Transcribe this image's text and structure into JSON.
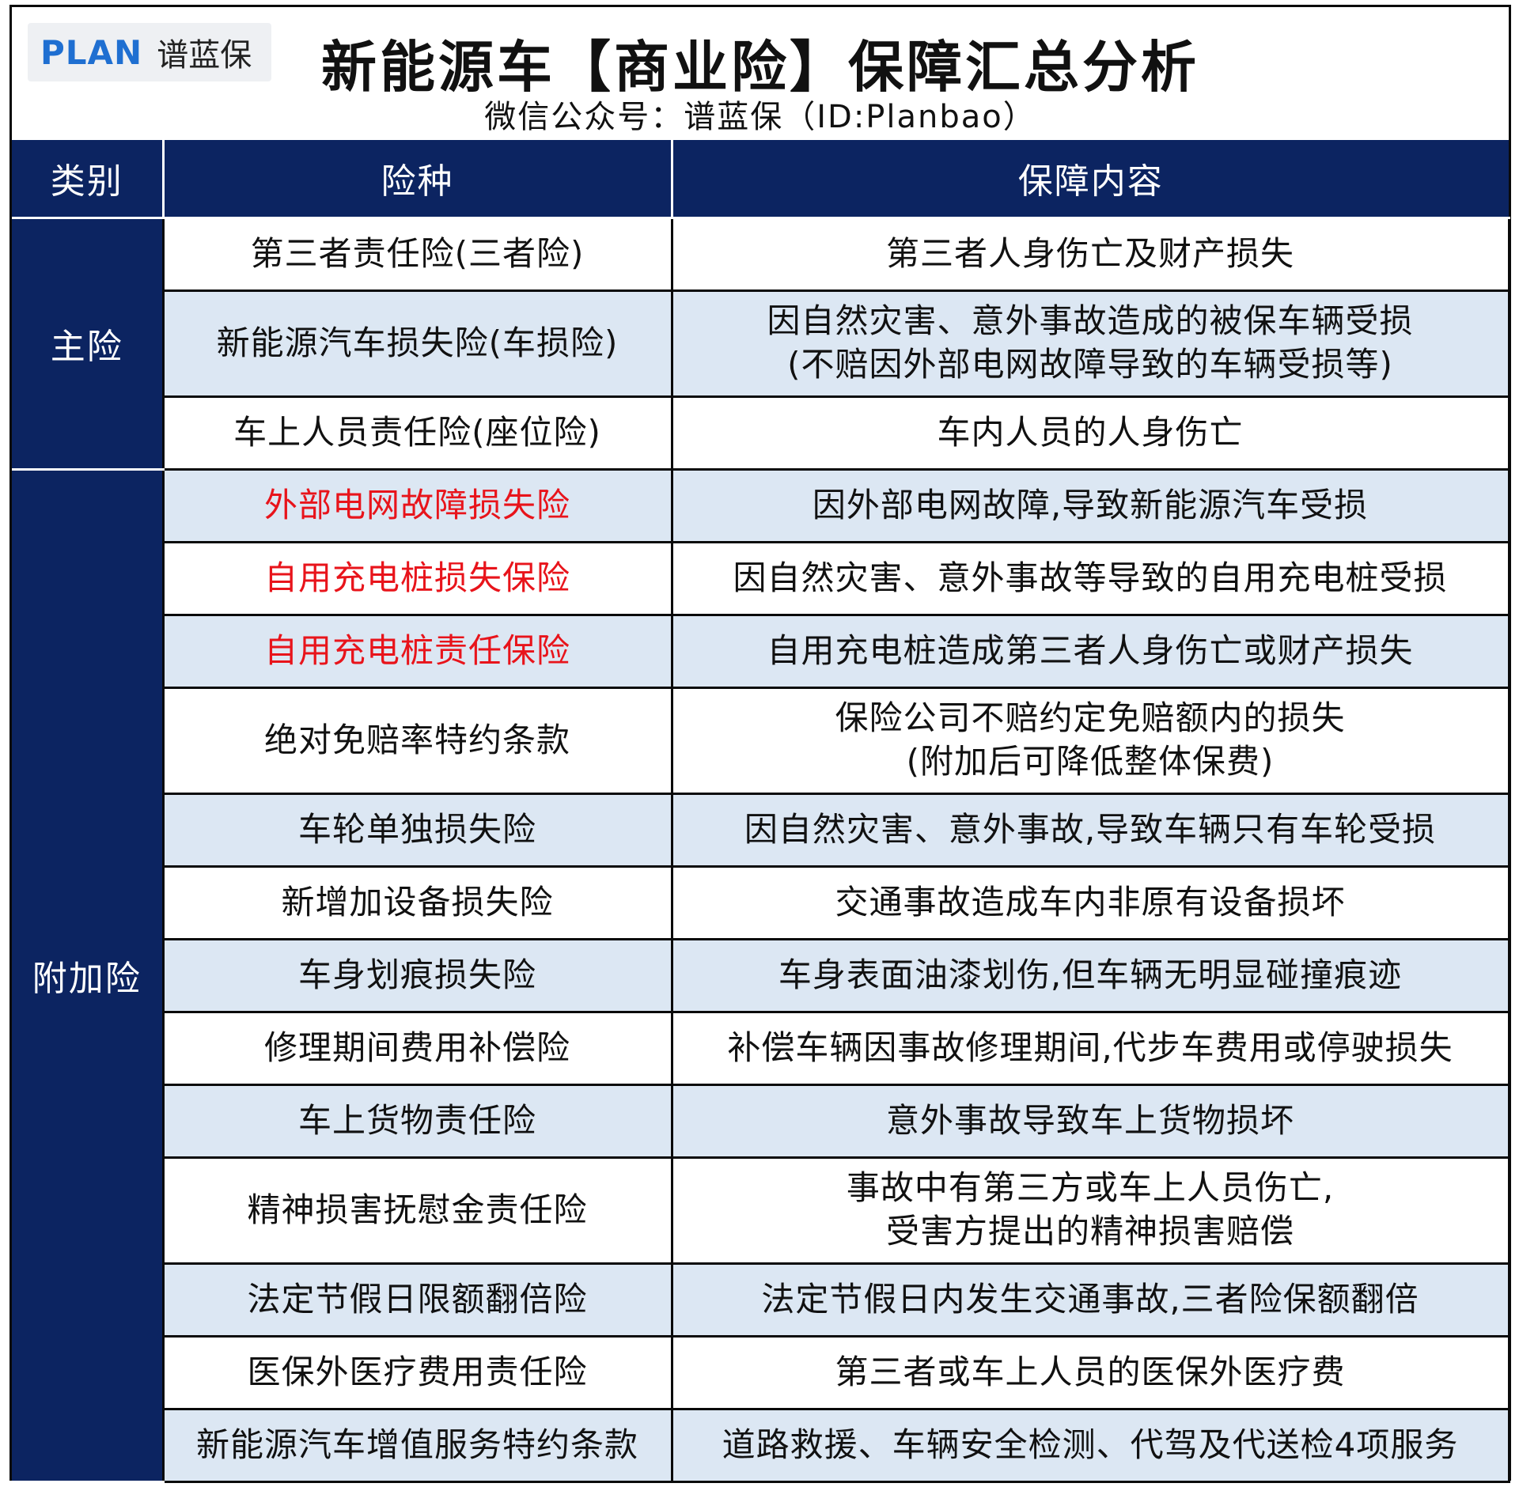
{
  "header": {
    "logo_mark": "PLAN",
    "logo_cn": "谱蓝保",
    "title": "新能源车【商业险】保障汇总分析",
    "subtitle": "微信公众号：谱蓝保（ID:Planbao）"
  },
  "table": {
    "columns": [
      "类别",
      "险种",
      "保障内容"
    ],
    "categories": [
      "主险",
      "附加险"
    ],
    "rows": [
      {
        "type": "第三者责任险(三者险)",
        "desc": [
          "第三者人身伤亡及财产损失"
        ]
      },
      {
        "type": "新能源汽车损失险(车损险)",
        "desc": [
          "因自然灾害、意外事故造成的被保车辆受损",
          "(不赔因外部电网故障导致的车辆受损等)"
        ]
      },
      {
        "type": "车上人员责任险(座位险)",
        "desc": [
          "车内人员的人身伤亡"
        ]
      },
      {
        "type": "外部电网故障损失险",
        "desc": [
          "因外部电网故障,导致新能源汽车受损"
        ]
      },
      {
        "type": "自用充电桩损失保险",
        "desc": [
          "因自然灾害、意外事故等导致的自用充电桩受损"
        ]
      },
      {
        "type": "自用充电桩责任保险",
        "desc": [
          "自用充电桩造成第三者人身伤亡或财产损失"
        ]
      },
      {
        "type": "绝对免赔率特约条款",
        "desc": [
          "保险公司不赔约定免赔额内的损失",
          "(附加后可降低整体保费)"
        ]
      },
      {
        "type": "车轮单独损失险",
        "desc": [
          "因自然灾害、意外事故,导致车辆只有车轮受损"
        ]
      },
      {
        "type": "新增加设备损失险",
        "desc": [
          "交通事故造成车内非原有设备损坏"
        ]
      },
      {
        "type": "车身划痕损失险",
        "desc": [
          "车身表面油漆划伤,但车辆无明显碰撞痕迹"
        ]
      },
      {
        "type": "修理期间费用补偿险",
        "desc": [
          "补偿车辆因事故修理期间,代步车费用或停驶损失"
        ]
      },
      {
        "type": "车上货物责任险",
        "desc": [
          "意外事故导致车上货物损坏"
        ]
      },
      {
        "type": "精神损害抚慰金责任险",
        "desc": [
          "事故中有第三方或车上人员伤亡,",
          "受害方提出的精神损害赔偿"
        ]
      },
      {
        "type": "法定节假日限额翻倍险",
        "desc": [
          "法定节假日内发生交通事故,三者险保额翻倍"
        ]
      },
      {
        "type": "医保外医疗费用责任险",
        "desc": [
          "第三者或车上人员的医保外医疗费"
        ]
      },
      {
        "type": "新能源汽车增值服务特约条款",
        "desc": [
          "道路救援、车辆安全检测、代驾及代送检4项服务"
        ]
      }
    ]
  },
  "colors": {
    "header_bg": "#0c2461",
    "alt_row_bg": "#dce7f3",
    "highlight_text": "#e8141b",
    "logo_blue": "#1f6fd1"
  }
}
